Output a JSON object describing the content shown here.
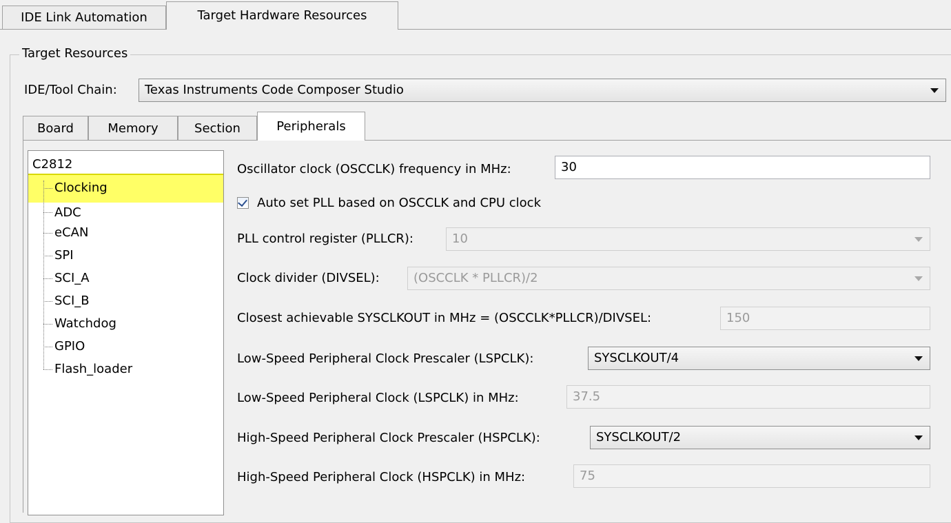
{
  "top_tabs": [
    {
      "label": "IDE Link Automation",
      "active": false
    },
    {
      "label": "Target Hardware Resources",
      "active": true
    }
  ],
  "group_title": "Target Resources",
  "toolchain": {
    "label": "IDE/Tool Chain:",
    "value": "Texas Instruments Code Composer Studio"
  },
  "inner_tabs": [
    {
      "label": "Board",
      "active": false
    },
    {
      "label": "Memory",
      "active": false
    },
    {
      "label": "Section",
      "active": false
    },
    {
      "label": "Peripherals",
      "active": true
    }
  ],
  "tree": {
    "root": "C2812",
    "items": [
      "Clocking",
      "ADC",
      "eCAN",
      "SPI",
      "SCI_A",
      "SCI_B",
      "Watchdog",
      "GPIO",
      "Flash_loader"
    ],
    "selected": "Clocking",
    "highlight_color": "#ffff66"
  },
  "clocking": {
    "osc_label": "Oscillator clock (OSCCLK) frequency in MHz:",
    "osc_value": "30",
    "auto_pll_label": "Auto set PLL based on OSCCLK and CPU clock",
    "auto_pll_checked": true,
    "pllcr_label": "PLL control register (PLLCR):",
    "pllcr_value": "10",
    "divsel_label": "Clock divider (DIVSEL):",
    "divsel_value": "(OSCCLK * PLLCR)/2",
    "sysclk_label": "Closest achievable SYSCLKOUT in MHz = (OSCCLK*PLLCR)/DIVSEL:",
    "sysclk_value": "150",
    "lsp_prescaler_label": "Low-Speed Peripheral Clock Prescaler (LSPCLK):",
    "lsp_prescaler_value": "SYSCLKOUT/4",
    "lsp_clk_label": "Low-Speed Peripheral Clock (LSPCLK) in MHz:",
    "lsp_clk_value": "37.5",
    "hsp_prescaler_label": "High-Speed Peripheral Clock Prescaler (HSPCLK):",
    "hsp_prescaler_value": "SYSCLKOUT/2",
    "hsp_clk_label": "High-Speed Peripheral Clock (HSPCLK) in MHz:",
    "hsp_clk_value": "75"
  }
}
